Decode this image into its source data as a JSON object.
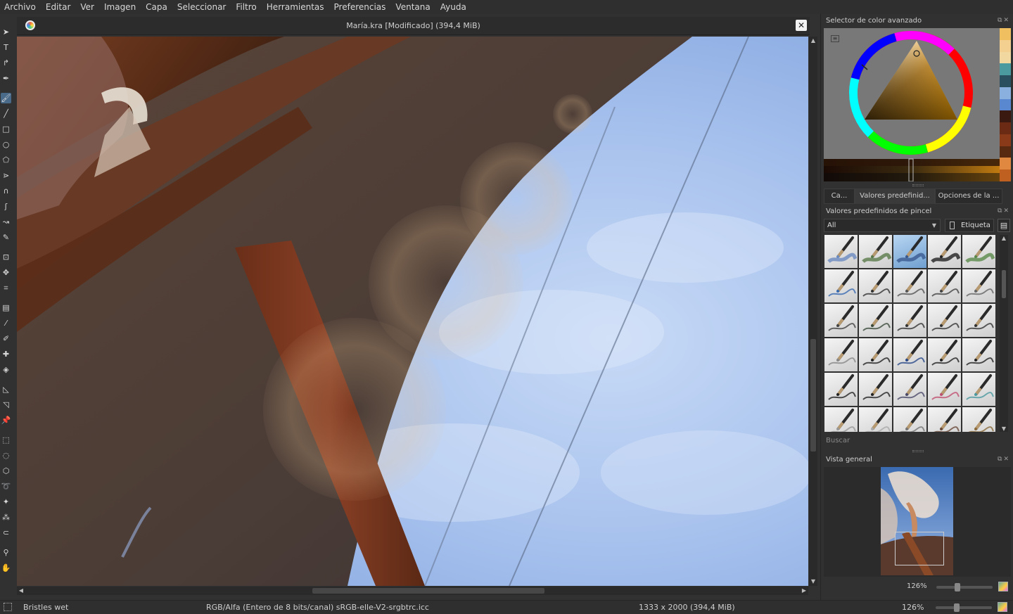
{
  "menu": [
    "Archivo",
    "Editar",
    "Ver",
    "Imagen",
    "Capa",
    "Seleccionar",
    "Filtro",
    "Herramientas",
    "Preferencias",
    "Ventana",
    "Ayuda"
  ],
  "document": {
    "title": "María.kra [Modificado]  (394,4 MiB)",
    "close_glyph": "✕"
  },
  "tools": [
    {
      "name": "select-shapes-tool",
      "glyph": "➤"
    },
    {
      "name": "text-tool",
      "glyph": "T"
    },
    {
      "name": "edit-shapes-tool",
      "glyph": "↱"
    },
    {
      "name": "calligraphy-tool",
      "glyph": "✒"
    },
    {
      "name": "freehand-brush-tool",
      "glyph": "🖌",
      "active": true
    },
    {
      "name": "line-tool",
      "glyph": "╱"
    },
    {
      "name": "rectangle-tool",
      "glyph": "□"
    },
    {
      "name": "ellipse-tool",
      "glyph": "○"
    },
    {
      "name": "polygon-tool",
      "glyph": "⬠"
    },
    {
      "name": "polyline-tool",
      "glyph": "⋗"
    },
    {
      "name": "bezier-tool",
      "glyph": "∩"
    },
    {
      "name": "freehand-path-tool",
      "glyph": "ʃ"
    },
    {
      "name": "dynamic-brush-tool",
      "glyph": "↝"
    },
    {
      "name": "multibrush-tool",
      "glyph": "✎"
    },
    {
      "name": "transform-tool",
      "glyph": "⊡"
    },
    {
      "name": "move-tool",
      "glyph": "✥"
    },
    {
      "name": "crop-tool",
      "glyph": "⌗"
    },
    {
      "name": "gradient-tool",
      "glyph": "▤"
    },
    {
      "name": "color-picker-tool",
      "glyph": "⁄"
    },
    {
      "name": "colorize-mask-tool",
      "glyph": "✐"
    },
    {
      "name": "smart-patch-tool",
      "glyph": "✚"
    },
    {
      "name": "fill-tool",
      "glyph": "◈"
    },
    {
      "name": "assistant-tool",
      "glyph": "◺"
    },
    {
      "name": "measure-tool",
      "glyph": "◹"
    },
    {
      "name": "reference-images-tool",
      "glyph": "📌"
    },
    {
      "name": "rectangular-selection-tool",
      "glyph": "⬚"
    },
    {
      "name": "elliptical-selection-tool",
      "glyph": "◌"
    },
    {
      "name": "polygonal-selection-tool",
      "glyph": "⬡"
    },
    {
      "name": "freehand-selection-tool",
      "glyph": "➰"
    },
    {
      "name": "contiguous-selection-tool",
      "glyph": "✦"
    },
    {
      "name": "similar-selection-tool",
      "glyph": "⁂"
    },
    {
      "name": "bezier-selection-tool",
      "glyph": "⊂"
    },
    {
      "name": "zoom-tool",
      "glyph": "⚲"
    },
    {
      "name": "pan-tool",
      "glyph": "✋"
    }
  ],
  "color_selector": {
    "title": "Selector de color avanzado",
    "swatches": [
      "#f0c060",
      "#f4d090",
      "#f0d8a0",
      "#4a9aa0",
      "#2a5060",
      "#8ab0e0",
      "#5a88d0",
      "#3a1a10",
      "#6a2a14",
      "#8a3a18",
      "#5a2a10",
      "#e08840",
      "#c06020"
    ]
  },
  "tabs": [
    {
      "name": "tab-ca",
      "label": "Ca...",
      "width": 44
    },
    {
      "name": "tab-brush-presets",
      "label": "Valores predefinid...",
      "width": 114,
      "active": true
    },
    {
      "name": "tab-tool-options",
      "label": "Opciones de la ...",
      "width": 96
    }
  ],
  "brush_presets": {
    "title": "Valores predefinidos de pincel",
    "tag_filter": "All",
    "tag_button": "Etiqueta",
    "search_placeholder": "Buscar",
    "count": 30,
    "selected_index": 2
  },
  "overview": {
    "title": "Vista general"
  },
  "zoom": {
    "docker_label": "126%",
    "status_label": "126%"
  },
  "status": {
    "brush_name": "Bristles wet",
    "color_space": "RGB/Alfa (Entero de 8 bits/canal)  sRGB-elle-V2-srgbtrc.icc",
    "image_size": "1333 x 2000 (394,4 MiB)"
  }
}
